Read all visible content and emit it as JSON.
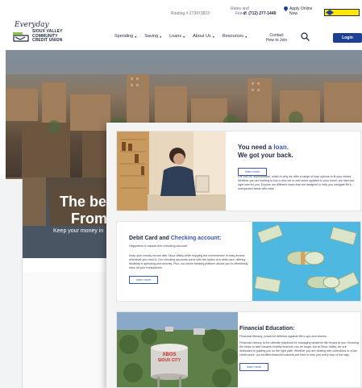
{
  "header": {
    "logo": {
      "script": "Everyday",
      "lines": [
        "SIOUX VALLEY",
        "COMMUNITY",
        "CREDIT UNION"
      ]
    },
    "routing": "Routing # 273973823",
    "rates": [
      "Rates and",
      "Fees"
    ],
    "phone": "(712) 277-1440",
    "apply": [
      "Apply Online",
      "Now"
    ],
    "partner_label": "Partner badge",
    "nav": [
      {
        "label": "Spending"
      },
      {
        "label": "Saving"
      },
      {
        "label": "Loans"
      },
      {
        "label": "About Us"
      },
      {
        "label": "Resources"
      }
    ],
    "contact": [
      "Contact",
      "How to Join"
    ],
    "login": "Login"
  },
  "hero": {
    "title_line1": "The bes",
    "title_line2": "From t",
    "subtitle": "Keep your money in"
  },
  "cards": {
    "loan": {
      "title_line1": "You need a ",
      "title_accent": "loan.",
      "title_line2": "We got your back.",
      "button": "learn more",
      "text": "Life can be unpredictable, which is why we offer a range of loan options to fit your needs. Whether you are looking to buy a new car or add some updates to your home, we have the right loan for you. Explore our different loans that are designed to help you navigate life's unexpected twists with ease."
    },
    "debit": {
      "title_part1": "Debit Card and ",
      "title_accent": "Checking account:",
      "lead": "Happiness is hassle-free checking account.",
      "text": "Keep your money secure with Sioux Valley while enjoying the convenience of easy access whenever you need it. Our checking accounts come with the option of a debit card, offering flexibility in spending and security. Plus, our online banking platform allows you to effortlessly track all your transactions.",
      "button": "learn more"
    },
    "education": {
      "title": "Financial Education:",
      "lead": "Financial literacy: powerful defense against life's ups and downs.",
      "text": "Financial Literacy is the ultimate playbook for managing whatever life throws at you. Knowing the steps to take towards healthy finances can be tough, but at Sioux Valley, we are dedicated to guiding you on the right path. Whether you are dealing with collections or a low credit score, our certified financial coaches are here to help you every step of the way.",
      "button": "learn more",
      "tower_text1": "XBOS",
      "tower_text2": "SIOUX CITY"
    }
  },
  "colors": {
    "brand_navy": "#1f2a44",
    "accent_blue": "#3a58b0",
    "login_blue": "#1f3f93",
    "logo_green": "#8cc63f"
  }
}
